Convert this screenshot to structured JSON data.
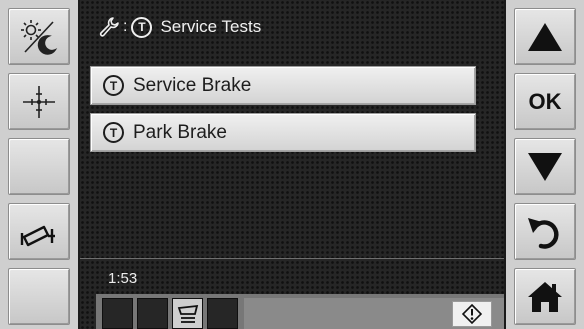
{
  "header": {
    "title": "Service Tests",
    "separator": ":"
  },
  "menu": {
    "items": [
      {
        "label": "Service Brake",
        "icon": "test-mode-icon"
      },
      {
        "label": "Park Brake",
        "icon": "test-mode-icon"
      }
    ]
  },
  "status": {
    "time": "1:53"
  },
  "icons": {
    "test_glyph": "T"
  },
  "right_panel": {
    "ok_label": "OK"
  },
  "colors": {
    "screen_bg": "#262626",
    "button_face": "#d9d9d9",
    "text": "#f0f0f0"
  }
}
